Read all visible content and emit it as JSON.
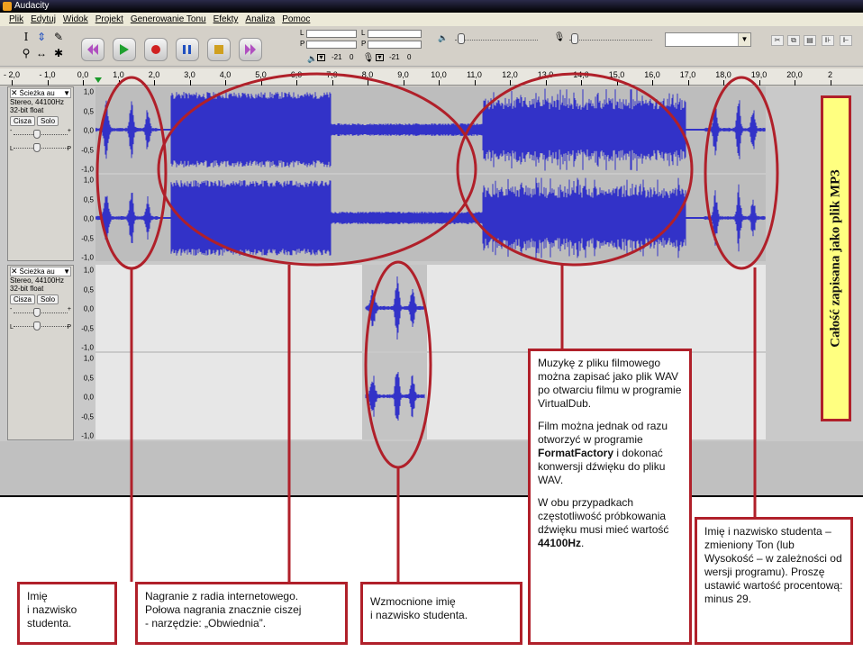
{
  "window": {
    "title": "Audacity"
  },
  "menu": [
    "Plik",
    "Edytuj",
    "Widok",
    "Projekt",
    "Generowanie Tonu",
    "Efekty",
    "Analiza",
    "Pomoc"
  ],
  "toolbar": {
    "tools": [
      "selection-tool",
      "envelope-tool",
      "draw-tool",
      "zoom-tool",
      "timeshift-tool",
      "multi-tool"
    ],
    "meter_left_label": "L",
    "meter_right_label": "P",
    "meter_scale_a": "-21",
    "meter_scale_b": "0",
    "combo_value": ""
  },
  "ruler": {
    "ticks": [
      "- 2,0",
      "- 1,0",
      "0,0",
      "1,0",
      "2,0",
      "3,0",
      "4,0",
      "5,0",
      "6,0",
      "7,0",
      "8,0",
      "9,0",
      "10,0",
      "11,0",
      "12,0",
      "13,0",
      "14,0",
      "15,0",
      "16,0",
      "17,0",
      "18,0",
      "19,0",
      "20,0",
      "2"
    ]
  },
  "tracks": [
    {
      "name": "Ścieżka au",
      "format_line1": "Stereo, 44100Hz",
      "format_line2": "32-bit float",
      "mute": "Cisza",
      "solo": "Solo",
      "gain_left": "-",
      "gain_right": "+",
      "pan_left": "L",
      "pan_right": "P",
      "scale": [
        "1,0",
        "0,5",
        "0,0",
        "-0,5",
        "-1,0"
      ]
    },
    {
      "name": "Ścieżka au",
      "format_line1": "Stereo, 44100Hz",
      "format_line2": "32-bit float",
      "mute": "Cisza",
      "solo": "Solo",
      "gain_left": "-",
      "gain_right": "+",
      "pan_left": "L",
      "pan_right": "P",
      "scale": [
        "1,0",
        "0,5",
        "0,0",
        "-0,5",
        "-1,0"
      ]
    }
  ],
  "annotations": {
    "name_student": "Imię\ni nazwisko\nstudenta.",
    "radio": "Nagranie z radia internetowego.\nPołowa nagrania znacznie ciszej\n- narzędzie: „Obwiednia”.",
    "amplified": "Wzmocnione imię\ni nazwisko studenta.",
    "music_p1": "Muzykę z pliku filmowego można zapisać jako plik WAV po otwarciu filmu w programie VirtualDub.",
    "music_p2_a": "Film można jednak od razu otworzyć w programie",
    "music_p2_bold": "FormatFactory",
    "music_p2_b": "i dokonać konwersji dźwięku do pliku WAV.",
    "music_p3_a": "W obu przypadkach częstotliwość próbkowania dźwięku musi mieć wartość",
    "music_p3_bold": "44100Hz",
    "music_p3_b": ".",
    "changed_tone": "Imię i nazwisko studenta – zmieniony Ton (lub Wysokość – w zależności od wersji programu). Proszę ustawić wartość procentową: minus 29.",
    "mp3": "Całość zapisana jako plik MP3"
  },
  "colors": {
    "wave": "#3232c8",
    "annotation_border": "#b0202a",
    "mp3_bg": "#ffff80"
  }
}
